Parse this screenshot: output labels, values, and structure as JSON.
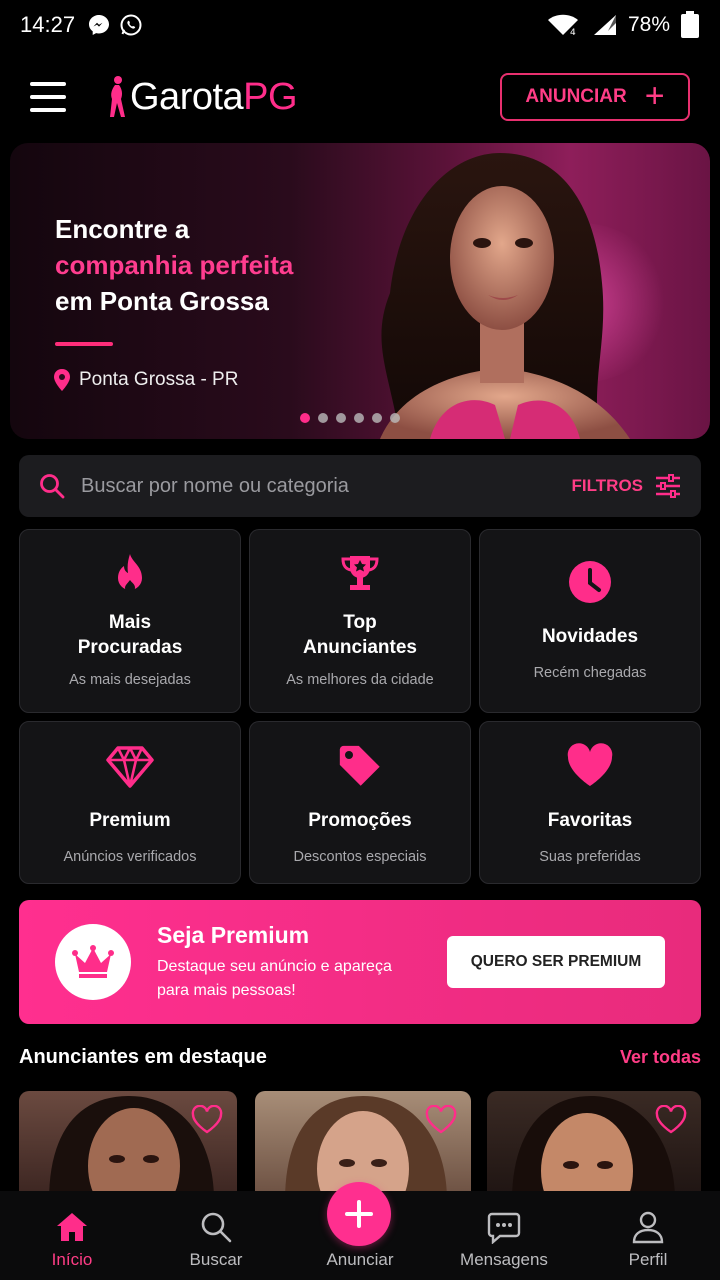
{
  "status_bar": {
    "time": "14:27",
    "battery_percent": "78%",
    "icons": [
      "messenger-icon",
      "whatsapp-icon",
      "wifi-icon",
      "signal-icon",
      "battery-icon"
    ]
  },
  "header": {
    "logo_part1": "Garota",
    "logo_part2": "PG",
    "anunciar_label": "ANUNCIAR"
  },
  "hero": {
    "line1": "Encontre a",
    "line2": "companhia perfeita",
    "line3": "em Ponta Grossa",
    "location": "Ponta Grossa - PR",
    "slide_count": 6,
    "active_slide": 0
  },
  "search": {
    "placeholder": "Buscar por nome ou categoria",
    "filter_label": "FILTROS"
  },
  "categories": [
    {
      "title": "Mais Procuradas",
      "subtitle": "As mais desejadas",
      "icon": "flame-icon"
    },
    {
      "title": "Top Anunciantes",
      "subtitle": "As melhores da cidade",
      "icon": "trophy-icon"
    },
    {
      "title": "Novidades",
      "subtitle": "Recém chegadas",
      "icon": "clock-icon"
    },
    {
      "title": "Premium",
      "subtitle": "Anúncios verificados",
      "icon": "diamond-icon"
    },
    {
      "title": "Promoções",
      "subtitle": "Descontos especiais",
      "icon": "tag-icon"
    },
    {
      "title": "Favoritas",
      "subtitle": "Suas preferidas",
      "icon": "heart-icon"
    }
  ],
  "premium": {
    "title": "Seja Premium",
    "description": "Destaque seu anúncio e apareça para mais pessoas!",
    "button_label": "QUERO SER PREMIUM"
  },
  "featured": {
    "title": "Anunciantes em destaque",
    "see_all": "Ver todas"
  },
  "bottom_nav": [
    {
      "label": "Início",
      "icon": "home-icon",
      "active": true
    },
    {
      "label": "Buscar",
      "icon": "search-icon",
      "active": false
    },
    {
      "label": "Anunciar",
      "icon": "plus-icon",
      "active": false
    },
    {
      "label": "Mensagens",
      "icon": "chat-icon",
      "active": false
    },
    {
      "label": "Perfil",
      "icon": "user-icon",
      "active": false
    }
  ],
  "colors": {
    "accent": "#ff2f8f",
    "background": "#000000",
    "card": "#141416"
  }
}
